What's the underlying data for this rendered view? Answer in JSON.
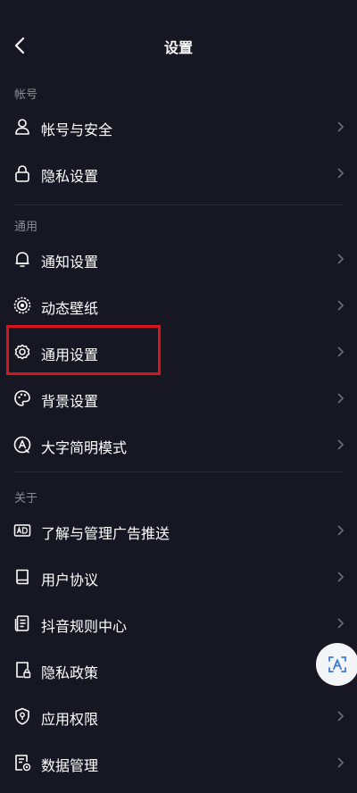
{
  "header": {
    "title": "设置"
  },
  "sections": {
    "account": "帐号",
    "general": "通用",
    "about": "关于"
  },
  "items": {
    "account_security": "帐号与安全",
    "privacy_settings": "隐私设置",
    "notification_settings": "通知设置",
    "live_wallpaper": "动态壁纸",
    "general_settings": "通用设置",
    "background_settings": "背景设置",
    "large_font_mode": "大字简明模式",
    "ad_management": "了解与管理广告推送",
    "user_agreement": "用户协议",
    "douyin_rules": "抖音规则中心",
    "privacy_policy": "隐私政策",
    "app_permissions": "应用权限",
    "data_management": "数据管理"
  },
  "icons": {
    "account_security": "user-icon",
    "privacy_settings": "lock-icon",
    "notification_settings": "bell-icon",
    "live_wallpaper": "wallpaper-icon",
    "general_settings": "gear-icon",
    "background_settings": "palette-icon",
    "large_font_mode": "font-mode-icon",
    "ad_management": "ad-icon",
    "user_agreement": "book-icon",
    "douyin_rules": "document-icon",
    "privacy_policy": "privacy-doc-icon",
    "app_permissions": "shield-icon",
    "data_management": "data-icon"
  },
  "colors": {
    "background": "#161723",
    "highlight": "#d8151f",
    "section_text": "#8a8b93"
  }
}
